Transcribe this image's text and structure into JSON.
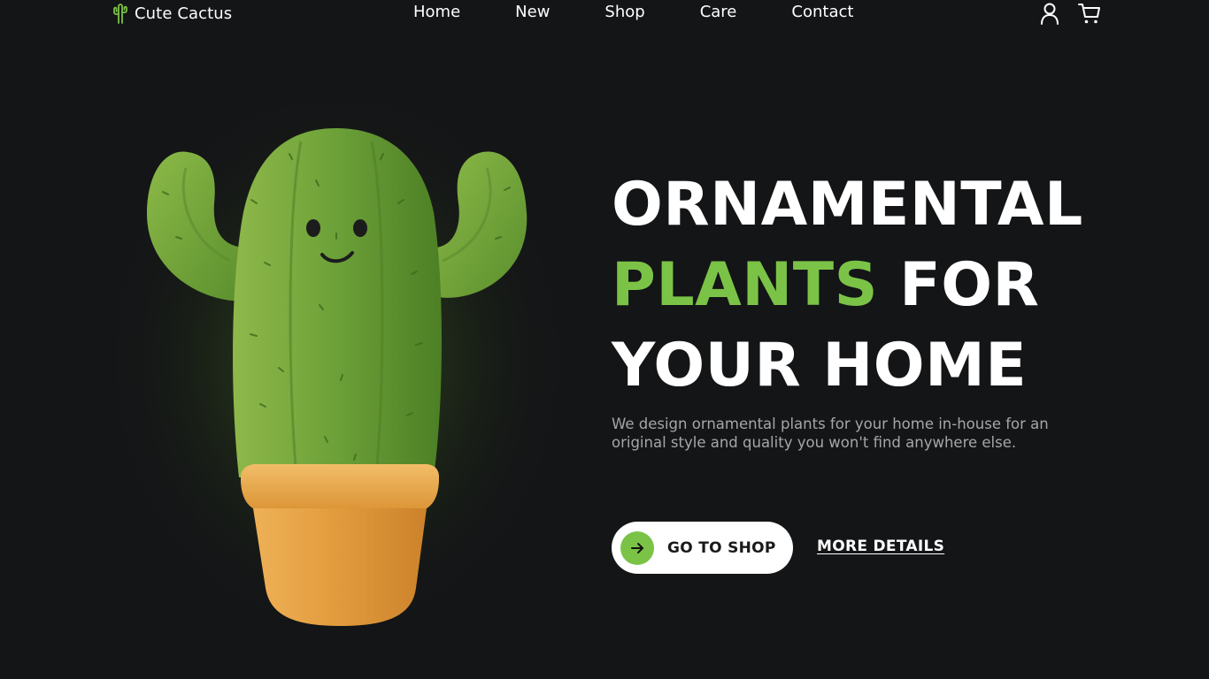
{
  "brand": {
    "name": "Cute Cactus",
    "icon": "cactus-icon"
  },
  "nav": {
    "items": [
      "Home",
      "New",
      "Shop",
      "Care",
      "Contact"
    ]
  },
  "header_actions": {
    "account_icon": "user-icon",
    "cart_icon": "cart-icon"
  },
  "hero": {
    "title_line1": "ORNAMENTAL",
    "title_accent": "PLANTS",
    "title_line2_rest": " FOR",
    "title_line3": "YOUR HOME",
    "description": "We design ornamental plants for your home in-house for an original style and quality you won't find anywhere else.",
    "primary_cta": "GO TO SHOP",
    "primary_cta_icon": "arrow-right-icon",
    "secondary_cta": "MORE DETAILS"
  },
  "colors": {
    "background": "#141517",
    "accent": "#7bc347",
    "text": "#ffffff",
    "muted": "#a6a6aa",
    "pot": "#e09a3c"
  }
}
